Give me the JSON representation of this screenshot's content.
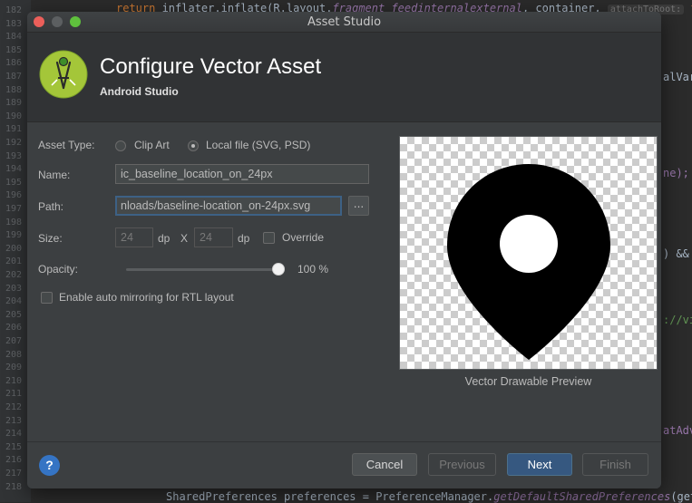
{
  "ide": {
    "line_numbers": [
      "182",
      "183",
      "184",
      "185",
      "186",
      "187",
      "188",
      "189",
      "190",
      "191",
      "192",
      "193",
      "194",
      "195",
      "196",
      "197",
      "198",
      "199",
      "200",
      "201",
      "202",
      "203",
      "204",
      "205",
      "206",
      "207",
      "208",
      "209",
      "210",
      "211",
      "212",
      "213",
      "214",
      "215",
      "216",
      "217",
      "218"
    ],
    "top_code": {
      "kw": "return",
      "text1": " inflater.inflate(R.layout.",
      "italic": "fragment_feedinternalexternal",
      "text2": ", container, ",
      "hint": "attachToRoot:",
      "kw2": " false"
    },
    "right_snippets": [
      "alVari",
      "ne);",
      ") &&",
      "://vi",
      "atAdv"
    ],
    "bottom_code": {
      "text1": "SharedPreferences preferences = PreferenceManager.",
      "italic": "getDefaultSharedPreferences",
      "text2": "(getAc"
    }
  },
  "dialog": {
    "window_title": "Asset Studio",
    "header": {
      "title": "Configure Vector Asset",
      "subtitle": "Android Studio"
    },
    "form": {
      "asset_type_label": "Asset Type:",
      "clip_art_label": "Clip Art",
      "local_file_label": "Local file (SVG, PSD)",
      "selected_type": "Local file (SVG, PSD)",
      "name_label": "Name:",
      "name_value": "ic_baseline_location_on_24px",
      "path_label": "Path:",
      "path_value": "nloads/baseline-location_on-24px.svg",
      "browse_label": "...",
      "size_label": "Size:",
      "width_value": "24",
      "height_value": "24",
      "dp_unit": "dp",
      "x_label": "X",
      "override_label": "Override",
      "override_checked": false,
      "opacity_label": "Opacity:",
      "opacity_percent": 100,
      "opacity_text": "100 %",
      "rtl_label": "Enable auto mirroring for RTL layout",
      "rtl_checked": false
    },
    "preview": {
      "caption": "Vector Drawable Preview",
      "icon": "location-pin-icon",
      "icon_color": "#000000"
    },
    "footer": {
      "help_label": "?",
      "cancel_label": "Cancel",
      "previous_label": "Previous",
      "next_label": "Next",
      "finish_label": "Finish"
    }
  },
  "colors": {
    "accent": "#365880",
    "help": "#3574c4",
    "android_green": "#a4c639"
  }
}
